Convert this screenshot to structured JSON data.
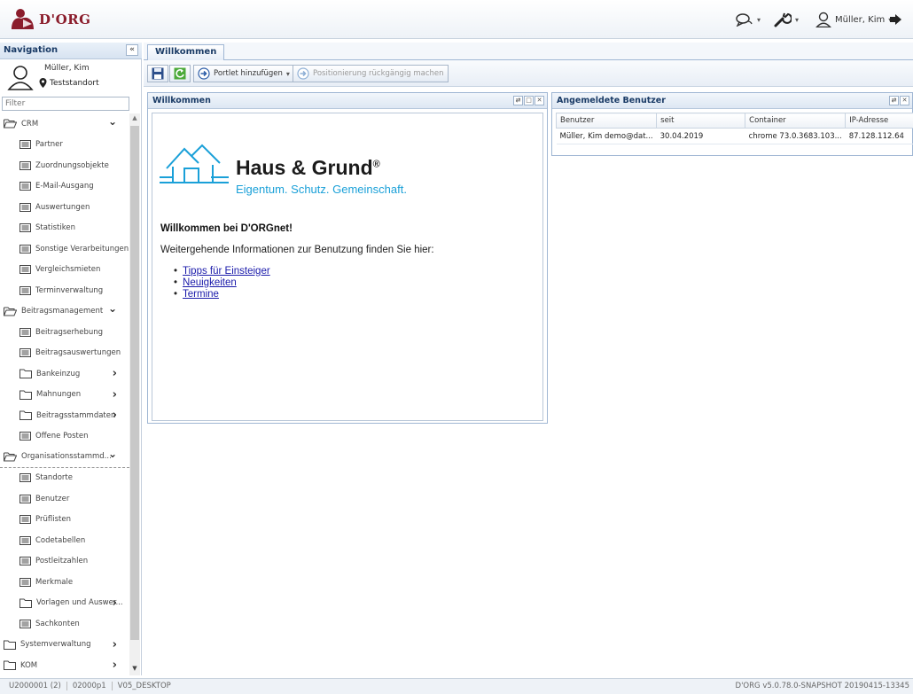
{
  "app": {
    "logo_text": "D'ORG"
  },
  "header": {
    "user_label": "Müller, Kim"
  },
  "colors": {
    "brand": "#8b1d2c",
    "accent": "#1aa0d8",
    "header_text": "#1a3b66"
  },
  "navigation": {
    "title": "Navigation",
    "collapse_label": "«",
    "user_name": "Müller, Kim",
    "location": "Teststandort",
    "filter_placeholder": "Filter",
    "items": [
      {
        "label": "CRM",
        "type": "folder-open",
        "arrow": "expanded"
      },
      {
        "label": "Partner",
        "type": "leaf"
      },
      {
        "label": "Zuordnungsobjekte",
        "type": "leaf"
      },
      {
        "label": "E-Mail-Ausgang",
        "type": "leaf"
      },
      {
        "label": "Auswertungen",
        "type": "leaf"
      },
      {
        "label": "Statistiken",
        "type": "leaf"
      },
      {
        "label": "Sonstige Verarbeitungen",
        "type": "leaf"
      },
      {
        "label": "Vergleichsmieten",
        "type": "leaf"
      },
      {
        "label": "Terminverwaltung",
        "type": "leaf"
      },
      {
        "label": "Beitragsmanagement",
        "type": "folder-open",
        "arrow": "expanded"
      },
      {
        "label": "Beitragserhebung",
        "type": "leaf"
      },
      {
        "label": "Beitragsauswertungen",
        "type": "leaf"
      },
      {
        "label": "Bankeinzug",
        "type": "folder-sub",
        "arrow": "collapsed"
      },
      {
        "label": "Mahnungen",
        "type": "folder-sub",
        "arrow": "collapsed"
      },
      {
        "label": "Beitragsstammdaten",
        "type": "folder-sub",
        "arrow": "collapsed"
      },
      {
        "label": "Offene Posten",
        "type": "leaf"
      },
      {
        "label": "Organisationsstammd...",
        "type": "folder-open",
        "arrow": "expanded",
        "dashed": true
      },
      {
        "label": "Standorte",
        "type": "leaf"
      },
      {
        "label": "Benutzer",
        "type": "leaf"
      },
      {
        "label": "Prüflisten",
        "type": "leaf"
      },
      {
        "label": "Codetabellen",
        "type": "leaf"
      },
      {
        "label": "Postleitzahlen",
        "type": "leaf"
      },
      {
        "label": "Merkmale",
        "type": "leaf"
      },
      {
        "label": "Vorlagen und Auswer...",
        "type": "folder-sub",
        "arrow": "collapsed"
      },
      {
        "label": "Sachkonten",
        "type": "leaf"
      },
      {
        "label": "Systemverwaltung",
        "type": "folder",
        "arrow": "collapsed"
      },
      {
        "label": "KOM",
        "type": "folder",
        "arrow": "collapsed"
      }
    ]
  },
  "tabs": [
    {
      "label": "Willkommen",
      "active": true
    }
  ],
  "toolbar": {
    "add_portlet_label": "Portlet hinzufügen",
    "undo_position_label": "Positionierung rückgängig machen"
  },
  "welcome_portlet": {
    "title": "Willkommen",
    "logo_name": "Haus & Grund",
    "logo_reg": "®",
    "logo_claim": "Eigentum. Schutz. Gemeinschaft.",
    "heading": "Willkommen bei D'ORGnet!",
    "info": "Weitergehende Informationen zur Benutzung finden Sie hier:",
    "links": [
      "Tipps für Einsteiger",
      "Neuigkeiten",
      "Termine"
    ]
  },
  "users_portlet": {
    "title": "Angemeldete Benutzer",
    "columns": [
      "Benutzer",
      "seit",
      "Container",
      "IP-Adresse"
    ],
    "rows": [
      [
        "Müller, Kim demo@dat...",
        "30.04.2019",
        "chrome 73.0.3683.103...",
        "87.128.112.64"
      ]
    ]
  },
  "status": {
    "segments": [
      "U2000001 (2)",
      "02000p1",
      "V05_DESKTOP"
    ],
    "version": "D'ORG v5.0.78.0-SNAPSHOT 20190415-13345"
  }
}
